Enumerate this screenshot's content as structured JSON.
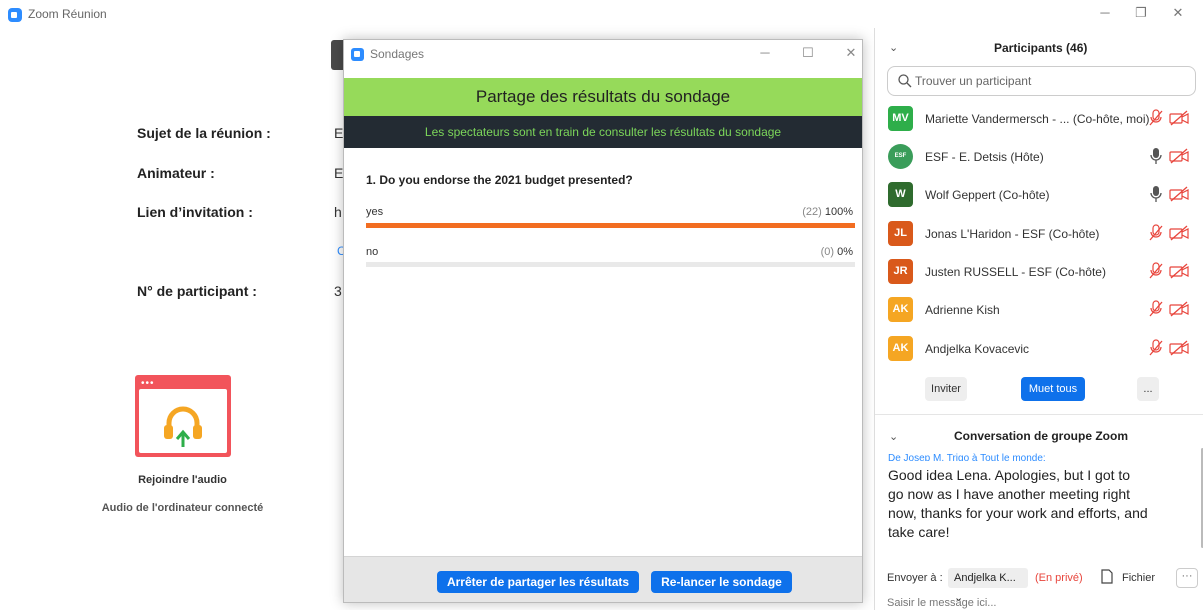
{
  "app": {
    "title": "Zoom Réunion",
    "minimize": "─",
    "restore": "❐",
    "close": "✕"
  },
  "meeting": {
    "topic_label": "Sujet de la réunion :",
    "topic_value": "E",
    "host_label": "Animateur :",
    "host_value": "E",
    "invite_label": "Lien d’invitation :",
    "invite_value": "h",
    "invite_copy": "C",
    "participant_no_label": "N° de participant :",
    "participant_no_value": "3"
  },
  "audio": {
    "dots": "•••",
    "join_label": "Rejoindre l'audio",
    "computer_audio": "Audio de l'ordinateur connecté"
  },
  "poll": {
    "window_title": "Sondages",
    "minimize": "─",
    "maximize": "☐",
    "close": "✕",
    "banner": "Partage des résultats du sondage",
    "status": "Les spectateurs sont en train de consulter les résultats du sondage",
    "question": "1. Do you endorse the 2021 budget presented?",
    "options": [
      {
        "label": "yes",
        "count": "(22)",
        "percent": "100%",
        "fraction": 1.0
      },
      {
        "label": "no",
        "count": "(0)",
        "percent": "0%",
        "fraction": 0.0
      }
    ],
    "stop_button": "Arrêter de partager les résultats",
    "relaunch_button": "Re-lancer le sondage"
  },
  "participants": {
    "header": "Participants (46)",
    "search_placeholder": "Trouver un participant",
    "items": [
      {
        "initials": "MV",
        "color": "#2EAE4A",
        "name": "Mariette Vandermersch - ...  (Co-hôte, moi)",
        "mic": "muted",
        "cam": "off"
      },
      {
        "initials": "ESF",
        "color": "#3A9D5A",
        "name": "ESF - E. Detsis (Hôte)",
        "mic": "on",
        "cam": "off"
      },
      {
        "initials": "W",
        "color": "#2F6B2E",
        "name": "Wolf Geppert (Co-hôte)",
        "mic": "on",
        "cam": "off"
      },
      {
        "initials": "JL",
        "color": "#D9591B",
        "name": "Jonas L'Haridon - ESF (Co-hôte)",
        "mic": "muted",
        "cam": "off"
      },
      {
        "initials": "JR",
        "color": "#D9591B",
        "name": "Justen RUSSELL - ESF (Co-hôte)",
        "mic": "muted",
        "cam": "off"
      },
      {
        "initials": "AK",
        "color": "#F5A623",
        "name": "Adrienne Kish",
        "mic": "muted",
        "cam": "off"
      },
      {
        "initials": "AK",
        "color": "#F5A623",
        "name": "Andjelka Kovacevic",
        "mic": "muted",
        "cam": "off"
      }
    ],
    "invite_button": "Inviter",
    "mute_all_button": "Muet tous",
    "more_button": "..."
  },
  "chat": {
    "header": "Conversation de groupe Zoom",
    "meta": "De Josep M. Trigo à Tout le monde:",
    "message": "Good idea Lena. Apologies, but I got to go now as I have another meeting right now, thanks for your work and efforts, and take care!",
    "send_to_label": "Envoyer à :",
    "send_to_value": "Andjelka K... ⌄",
    "private_label": "(En privé)",
    "file_label": "Fichier",
    "more_label": "···",
    "input_placeholder": "Saisir le message ici..."
  },
  "colors": {
    "accent": "#0E71EB",
    "banner": "#96DA5A",
    "bar": "#F26D21",
    "muted_red": "#E8453C"
  }
}
